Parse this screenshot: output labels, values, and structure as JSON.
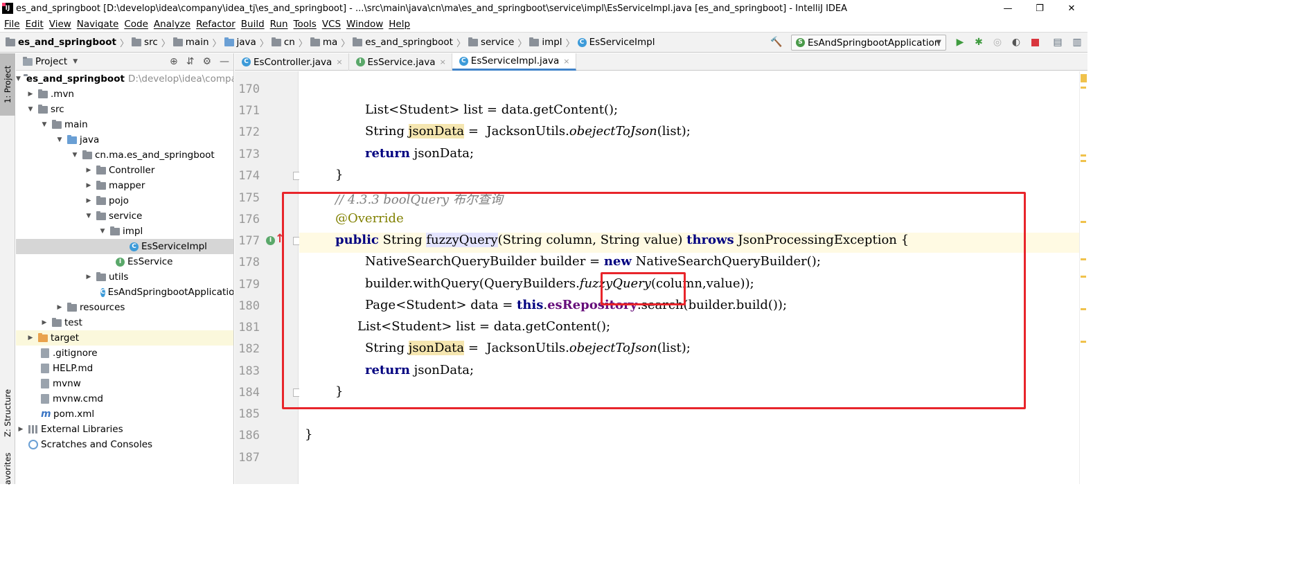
{
  "window": {
    "title": "es_and_springboot [D:\\develop\\idea\\company\\idea_tj\\es_and_springboot] - ...\\src\\main\\java\\cn\\ma\\es_and_springboot\\service\\impl\\EsServiceImpl.java [es_and_springboot] - IntelliJ IDEA",
    "app_icon_text": "IJ",
    "minimize": "—",
    "restore": "❐",
    "close": "✕"
  },
  "menu": [
    "File",
    "Edit",
    "View",
    "Navigate",
    "Code",
    "Analyze",
    "Refactor",
    "Build",
    "Run",
    "Tools",
    "VCS",
    "Window",
    "Help"
  ],
  "breadcrumbs": [
    "es_and_springboot",
    "src",
    "main",
    "java",
    "cn",
    "ma",
    "es_and_springboot",
    "service",
    "impl",
    "EsServiceImpl"
  ],
  "run_config": {
    "name": "EsAndSpringbootApplication"
  },
  "toolbar_icons": [
    "hammer-icon",
    "run-icon",
    "debug-icon",
    "coverage-icon",
    "profile-icon",
    "stop-icon",
    "project-structure-icon",
    "layout-icon"
  ],
  "left_strip": {
    "project_tab": "1: Project",
    "structure_tab": "Z: Structure",
    "favorites_tab": "avorites"
  },
  "project_panel": {
    "title": "Project",
    "tree": [
      {
        "label": "es_and_springboot",
        "hint": "D:\\develop\\idea\\company",
        "bold": true
      },
      {
        "label": ".mvn"
      },
      {
        "label": "src"
      },
      {
        "label": "main"
      },
      {
        "label": "java"
      },
      {
        "label": "cn.ma.es_and_springboot"
      },
      {
        "label": "Controller"
      },
      {
        "label": "mapper"
      },
      {
        "label": "pojo"
      },
      {
        "label": "service"
      },
      {
        "label": "impl"
      },
      {
        "label": "EsServiceImpl"
      },
      {
        "label": "EsService"
      },
      {
        "label": "utils"
      },
      {
        "label": "EsAndSpringbootApplication"
      },
      {
        "label": "resources"
      },
      {
        "label": "test"
      },
      {
        "label": "target"
      },
      {
        "label": ".gitignore"
      },
      {
        "label": "HELP.md"
      },
      {
        "label": "mvnw"
      },
      {
        "label": "mvnw.cmd"
      },
      {
        "label": "pom.xml"
      },
      {
        "label": "External Libraries"
      },
      {
        "label": "Scratches and Consoles"
      }
    ]
  },
  "editor": {
    "tabs": [
      {
        "label": "EsController.java",
        "icon": "class-icon",
        "active": false
      },
      {
        "label": "EsService.java",
        "icon": "interface-icon",
        "active": false
      },
      {
        "label": "EsServiceImpl.java",
        "icon": "class-icon",
        "active": true
      }
    ],
    "tab_close": "×",
    "line_numbers": [
      "170",
      "171",
      "172",
      "173",
      "174",
      "175",
      "176",
      "177",
      "178",
      "179",
      "180",
      "181",
      "182",
      "183",
      "184",
      "185",
      "186",
      "187"
    ],
    "code": {
      "l171": [
        "List<Student> list = data.getContent();"
      ],
      "l172": [
        "String ",
        "jsonData",
        " =  JacksonUtils.",
        "obejectToJson",
        "(list);"
      ],
      "l173": [
        "return",
        " jsonData;"
      ],
      "l174": [
        "}"
      ],
      "l175": [
        "// 4.3.3 boolQuery 布尔查询"
      ],
      "l176": [
        "@Override"
      ],
      "l177": [
        "public",
        " String ",
        "fuzzyQuery",
        "(String column, String value) ",
        "throws",
        " JsonProcessingException {"
      ],
      "l178": [
        "NativeSearchQueryBuilder builder = ",
        "new",
        " NativeSearchQueryBuilder();"
      ],
      "l179": [
        "builder.withQuery(QueryBuilders.",
        "fuzzyQuery",
        "(column,value));"
      ],
      "l180": [
        "Page<Student> data = ",
        "this",
        ".",
        "esRepository",
        ".search(builder.build());"
      ],
      "l181": [
        "List<Student> list = data.getContent();"
      ],
      "l182": [
        "String ",
        "jsonData",
        " =  JacksonUtils.",
        "obejectToJson",
        "(list);"
      ],
      "l183": [
        "return",
        " jsonData;"
      ],
      "l184": [
        "}"
      ],
      "l186": [
        "}"
      ]
    }
  },
  "colors": {
    "keyword": "#000080",
    "comment": "#808080",
    "annotation": "#808000",
    "field": "#660e7a",
    "highlight_box": "#e8252b",
    "current_line": "#fffae3"
  }
}
